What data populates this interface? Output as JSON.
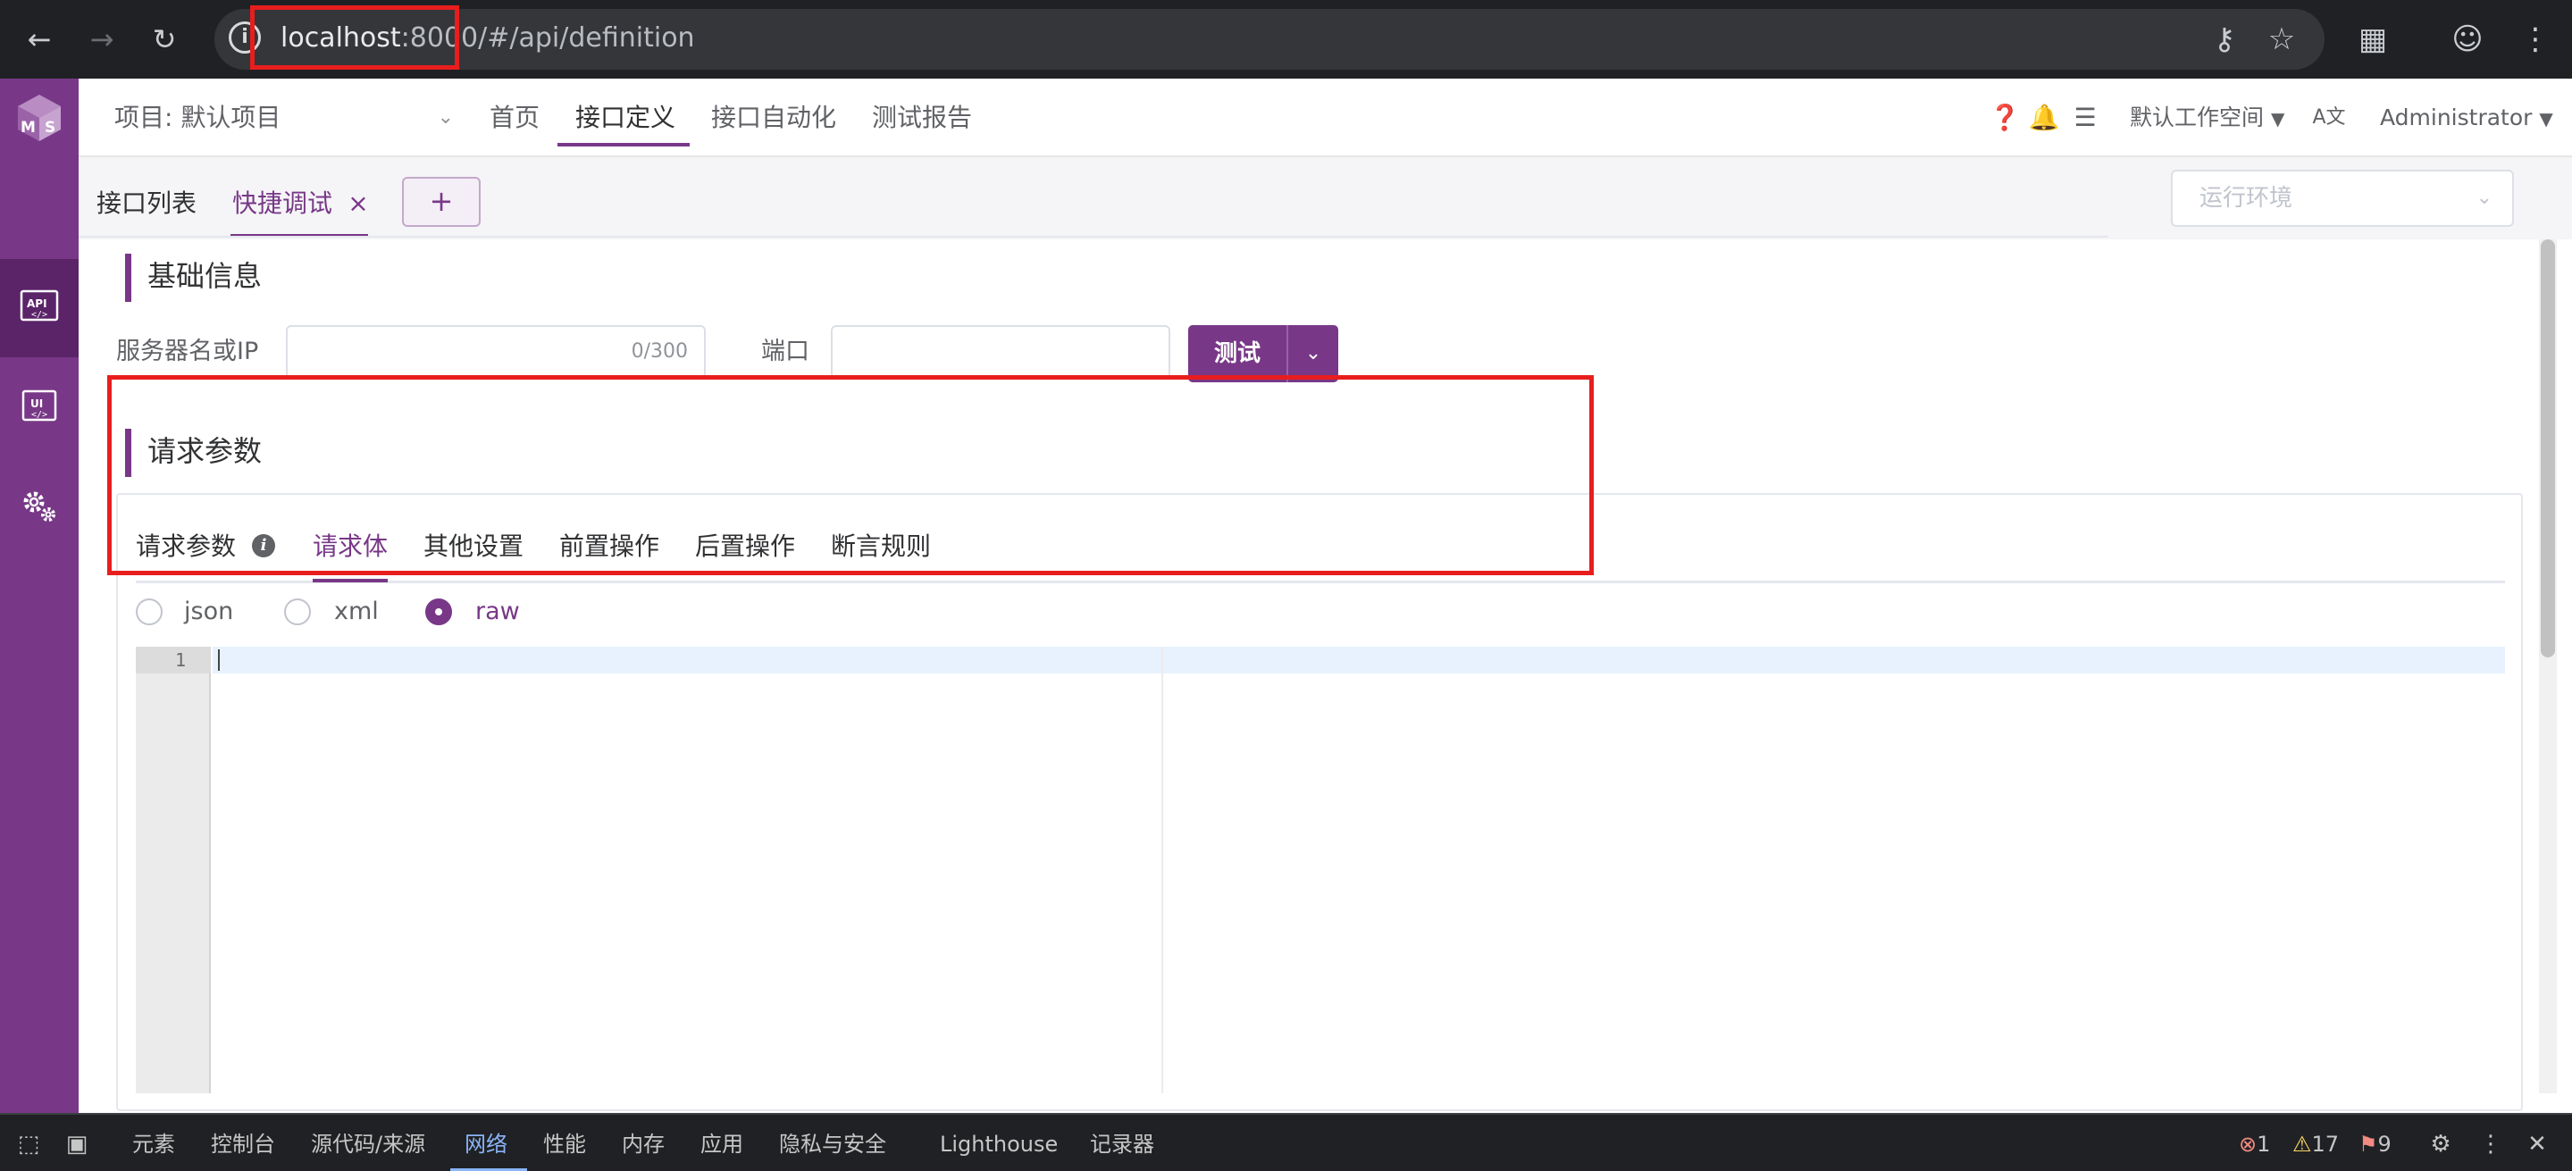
{
  "browser": {
    "url_host": "localhost",
    "url_port": ":8000",
    "url_path": "/#/api/definition"
  },
  "header": {
    "project_label": "项目: 默认项目",
    "nav": [
      "首页",
      "接口定义",
      "接口自动化",
      "测试报告"
    ],
    "active_nav": "接口定义",
    "workspace": "默认工作空间",
    "user": "Administrator"
  },
  "sidebar": {
    "items": [
      {
        "icon": "api-icon",
        "active": true
      },
      {
        "icon": "ui-icon",
        "active": false
      },
      {
        "icon": "settings-gears-icon",
        "active": false
      }
    ]
  },
  "tabs": {
    "list_tab": "接口列表",
    "debug_tab": "快捷调试",
    "close_symbol": "×",
    "add_symbol": "+",
    "env_placeholder": "运行环境"
  },
  "basic_info": {
    "title": "基础信息",
    "server_label": "服务器名或IP",
    "server_counter": "0/300",
    "port_label": "端口",
    "test_button": "测试"
  },
  "request": {
    "title": "请求参数",
    "tabs": [
      "请求参数",
      "请求体",
      "其他设置",
      "前置操作",
      "后置操作",
      "断言规则"
    ],
    "active_tab": "请求体",
    "body_types": [
      "json",
      "xml",
      "raw"
    ],
    "selected_body_type": "raw",
    "editor_line": "1"
  },
  "devtools": {
    "tabs": [
      "元素",
      "控制台",
      "源代码/来源",
      "网络",
      "性能",
      "内存",
      "应用",
      "隐私与安全",
      "Lighthouse",
      "记录器"
    ],
    "active_tab": "网络",
    "errors": "1",
    "warnings": "17",
    "issues": "9"
  },
  "colors": {
    "brand": "#783887",
    "annotation": "#e81e1e"
  }
}
